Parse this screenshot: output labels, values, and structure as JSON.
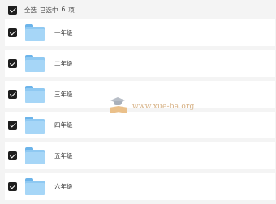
{
  "header": {
    "select_all_label": "全选",
    "selected_prefix": "已选中",
    "selected_count": "6",
    "selected_unit": "项"
  },
  "items": [
    {
      "name": "一年级",
      "checked": true,
      "icon": "folder-icon"
    },
    {
      "name": "二年级",
      "checked": true,
      "icon": "folder-icon"
    },
    {
      "name": "三年级",
      "checked": true,
      "icon": "folder-icon"
    },
    {
      "name": "四年级",
      "checked": true,
      "icon": "folder-icon"
    },
    {
      "name": "五年级",
      "checked": true,
      "icon": "folder-icon"
    },
    {
      "name": "六年级",
      "checked": true,
      "icon": "folder-icon"
    }
  ],
  "watermark": {
    "text": "www.xue-ba.org",
    "icon": "graduation-cap-book-logo"
  },
  "colors": {
    "checkbox": "#1e1e1e",
    "folder": "#8fc9f2",
    "row_background": "#ffffff",
    "page_background": "#f4f4f4"
  }
}
